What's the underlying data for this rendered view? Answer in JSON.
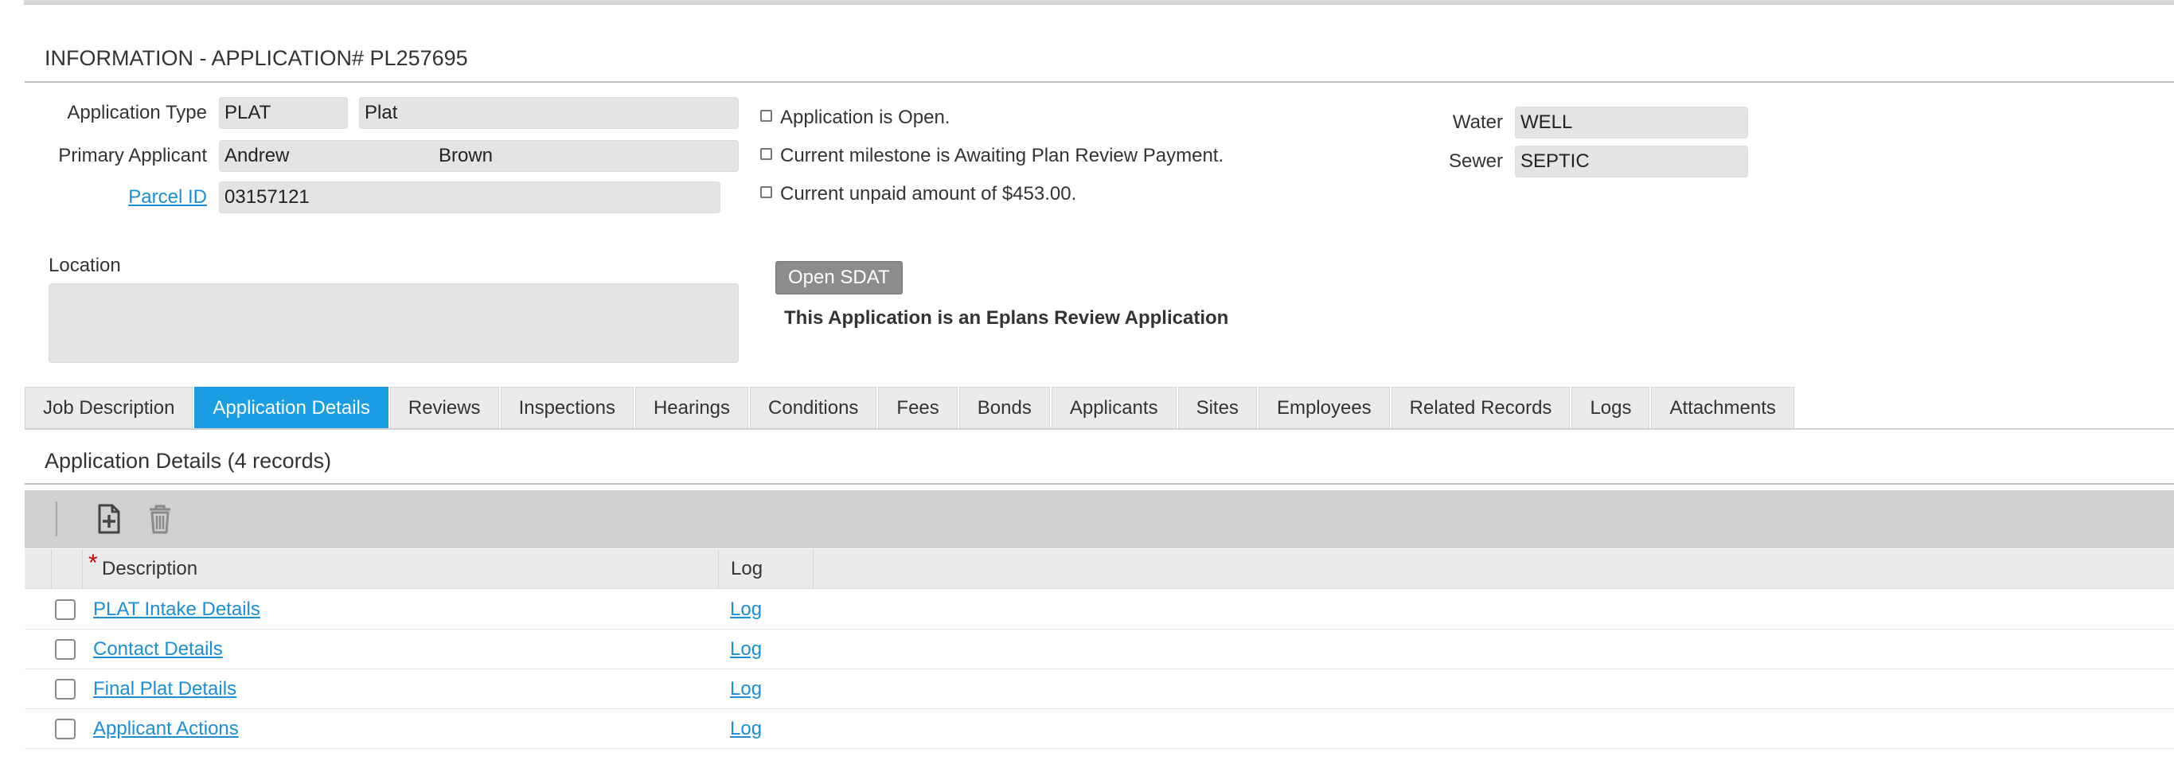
{
  "header": {
    "title": "INFORMATION - APPLICATION# PL257695"
  },
  "info": {
    "application_type": {
      "label": "Application Type",
      "code": "PLAT",
      "name": "Plat"
    },
    "primary_applicant": {
      "label": "Primary Applicant",
      "first_name": "Andrew",
      "last_name": "Brown"
    },
    "parcel": {
      "label": "Parcel ID",
      "value": "03157121"
    },
    "location": {
      "label": "Location",
      "value": ""
    }
  },
  "status_lines": [
    "Application is Open.",
    "Current milestone is Awaiting Plan Review Payment.",
    "Current unpaid amount of $453.00."
  ],
  "utilities": {
    "water": {
      "label": "Water",
      "value": "WELL"
    },
    "sewer": {
      "label": "Sewer",
      "value": "SEPTIC"
    }
  },
  "open_sdat_label": "Open SDAT",
  "eplans_notice": "This Application is an Eplans Review Application",
  "tabs": [
    {
      "label": "Job Description",
      "active": false
    },
    {
      "label": "Application Details",
      "active": true
    },
    {
      "label": "Reviews",
      "active": false
    },
    {
      "label": "Inspections",
      "active": false
    },
    {
      "label": "Hearings",
      "active": false
    },
    {
      "label": "Conditions",
      "active": false
    },
    {
      "label": "Fees",
      "active": false
    },
    {
      "label": "Bonds",
      "active": false
    },
    {
      "label": "Applicants",
      "active": false
    },
    {
      "label": "Sites",
      "active": false
    },
    {
      "label": "Employees",
      "active": false
    },
    {
      "label": "Related Records",
      "active": false
    },
    {
      "label": "Logs",
      "active": false
    },
    {
      "label": "Attachments",
      "active": false
    }
  ],
  "details": {
    "title": "Application Details (4 records)",
    "toolbar": {
      "add_icon": "add-document-icon",
      "delete_icon": "trash-icon"
    },
    "columns": {
      "required_mark": "*",
      "description": "Description",
      "log": "Log"
    },
    "rows": [
      {
        "description": "PLAT Intake Details",
        "log": "Log"
      },
      {
        "description": "Contact Details",
        "log": "Log"
      },
      {
        "description": "Final Plat Details",
        "log": "Log"
      },
      {
        "description": "Applicant Actions",
        "log": "Log"
      }
    ]
  },
  "colors": {
    "accent": "#1b9de4",
    "link": "#1a8fd6",
    "required": "#cc0000",
    "field_bg": "#e4e4e4"
  }
}
